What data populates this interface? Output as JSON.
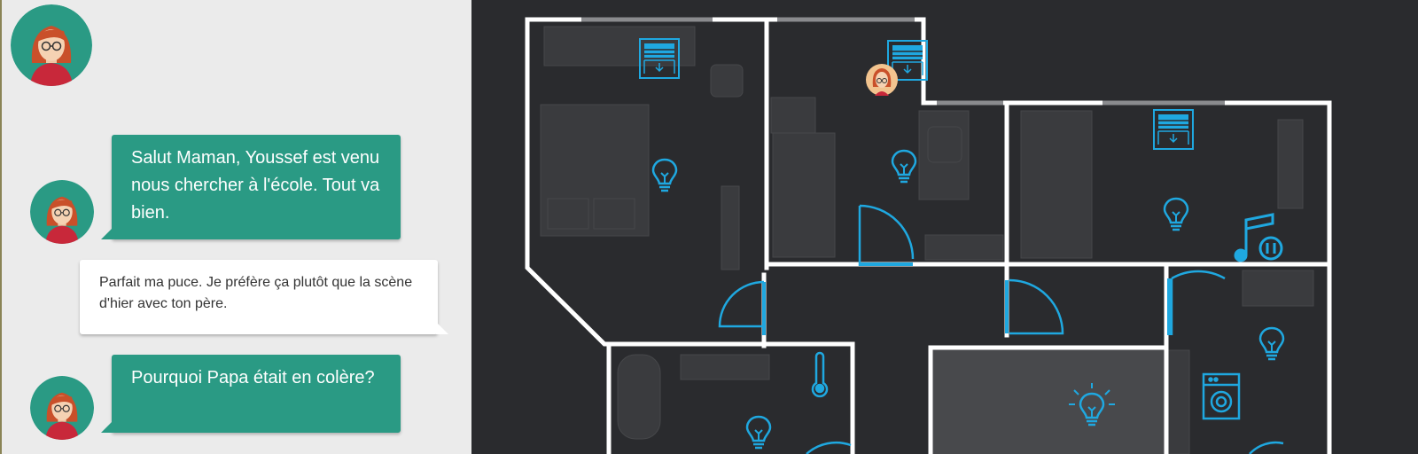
{
  "chat": {
    "messages": [
      {
        "sender": "child",
        "text": "Salut Maman, Youssef est venu nous chercher à l'école. Tout va bien."
      },
      {
        "sender": "mother",
        "text": "Parfait ma puce. Je préfère ça plutôt que la scène d'hier avec ton père."
      },
      {
        "sender": "child",
        "text": "Pourquoi Papa était en colère?"
      }
    ]
  },
  "colors": {
    "chat_background": "#ebebeb",
    "outgoing_bubble": "#2a9a84",
    "incoming_bubble": "#ffffff",
    "plan_background": "#2a2b2e",
    "walls": "#ffffff",
    "accent": "#1fa8e0"
  },
  "floorplan": {
    "devices": [
      {
        "icon": "window-blind-icon",
        "room": "bedroom-1"
      },
      {
        "icon": "window-blind-icon",
        "room": "bedroom-2"
      },
      {
        "icon": "window-blind-icon",
        "room": "bedroom-3"
      },
      {
        "icon": "lightbulb-icon",
        "room": "bedroom-1",
        "state": "off"
      },
      {
        "icon": "lightbulb-icon",
        "room": "bedroom-2",
        "state": "off"
      },
      {
        "icon": "lightbulb-icon",
        "room": "bedroom-3",
        "state": "off"
      },
      {
        "icon": "lightbulb-icon",
        "room": "laundry",
        "state": "off"
      },
      {
        "icon": "lightbulb-icon",
        "room": "bathroom",
        "state": "off"
      },
      {
        "icon": "lightbulb-icon",
        "room": "kitchen",
        "state": "on"
      },
      {
        "icon": "thermometer-icon",
        "room": "bathroom"
      },
      {
        "icon": "music-pause-icon",
        "room": "bedroom-3"
      },
      {
        "icon": "washing-machine-icon",
        "room": "laundry"
      },
      {
        "icon": "user-location-icon",
        "room": "bedroom-2"
      }
    ]
  }
}
